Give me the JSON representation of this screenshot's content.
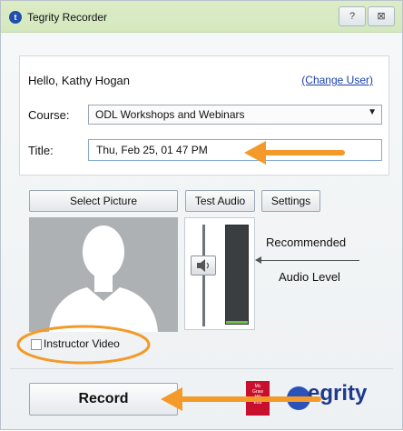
{
  "window": {
    "title": "Tegrity Recorder",
    "app_icon": "tegrity-icon",
    "help_button": "?",
    "close_button": "⊠"
  },
  "user": {
    "greeting": "Hello,  Kathy Hogan",
    "change_user_link": "(Change User)"
  },
  "course": {
    "label": "Course:",
    "selected": "ODL Workshops and Webinars"
  },
  "title_field": {
    "label": "Title:",
    "value": "Thu, Feb 25, 01 47 PM"
  },
  "buttons": {
    "select_picture": "Select Picture",
    "test_audio": "Test Audio",
    "settings": "Settings",
    "record": "Record"
  },
  "audio": {
    "recommended_label": "Recommended",
    "level_label": "Audio Level",
    "speaker_icon": "speaker-icon",
    "current_level_fraction": 0.03
  },
  "instructor_video": {
    "label": "Instructor Video",
    "checked": false
  },
  "branding": {
    "publisher_logo": "McGraw Hill Education",
    "product_logo": "egrity"
  },
  "colors": {
    "titlebar": "#d4e8bd",
    "annotation_orange": "#f39a2a",
    "link_blue": "#1a3fb0",
    "brand_blue": "#1e3a8a"
  }
}
